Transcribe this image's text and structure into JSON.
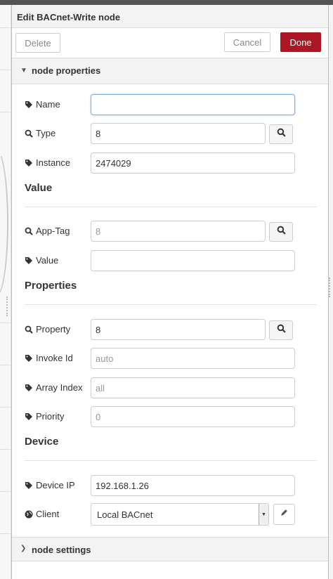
{
  "dialog": {
    "title": "Edit BACnet-Write node"
  },
  "toolbar": {
    "delete_label": "Delete",
    "cancel_label": "Cancel",
    "done_label": "Done",
    "done_color": "#ad1625"
  },
  "sections": {
    "node_properties": "node properties",
    "node_settings": "node settings"
  },
  "fields": {
    "name": {
      "label": "Name",
      "value": "",
      "icon": "tag-icon"
    },
    "type": {
      "label": "Type",
      "value": "8",
      "icon": "search-icon"
    },
    "instance": {
      "label": "Instance",
      "value": "2474029",
      "icon": "tag-icon"
    },
    "app_tag": {
      "label": "App-Tag",
      "placeholder": "8",
      "icon": "search-icon"
    },
    "value": {
      "label": "Value",
      "value": "",
      "icon": "tag-icon"
    },
    "property": {
      "label": "Property",
      "value": "8",
      "icon": "search-icon"
    },
    "invoke_id": {
      "label": "Invoke Id",
      "placeholder": "auto",
      "icon": "tag-icon"
    },
    "array_index": {
      "label": "Array Index",
      "placeholder": "all",
      "icon": "tag-icon"
    },
    "priority": {
      "label": "Priority",
      "placeholder": "0",
      "icon": "tag-icon"
    },
    "device_ip": {
      "label": "Device IP",
      "value": "192.168.1.26",
      "icon": "tag-icon"
    },
    "client": {
      "label": "Client",
      "value": "Local BACnet",
      "icon": "globe-icon"
    }
  },
  "headings": {
    "value": "Value",
    "properties": "Properties",
    "device": "Device"
  }
}
